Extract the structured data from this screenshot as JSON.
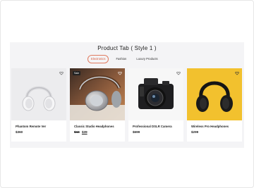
{
  "section": {
    "title": "Product Tab ( Style 1 )"
  },
  "tabs": [
    {
      "label": "Electronics",
      "active": true
    },
    {
      "label": "Fashion",
      "active": false
    },
    {
      "label": "Luxury Products",
      "active": false
    }
  ],
  "products": [
    {
      "name": "Phantom Remote Ver",
      "price": "$360",
      "badge": "",
      "old_price": "",
      "image": "white-headphones",
      "icon": "heart-icon"
    },
    {
      "name": "Classic Studio Headphones",
      "price": "$39",
      "old_price": "$44",
      "badge": "Sale",
      "image": "silver-headphones",
      "icon": "heart-icon"
    },
    {
      "name": "Professional DSLR Camera",
      "price": "$699",
      "badge": "",
      "old_price": "",
      "image": "dslr-camera",
      "icon": "heart-icon"
    },
    {
      "name": "Wireless Pro Headphones",
      "price": "$299",
      "badge": "",
      "old_price": "",
      "image": "black-headphones-yellow",
      "icon": "heart-icon"
    }
  ],
  "colors": {
    "accent": "#d9583a",
    "panel_bg": "#f4f4f6",
    "yellow_bg": "#f2c12e"
  }
}
